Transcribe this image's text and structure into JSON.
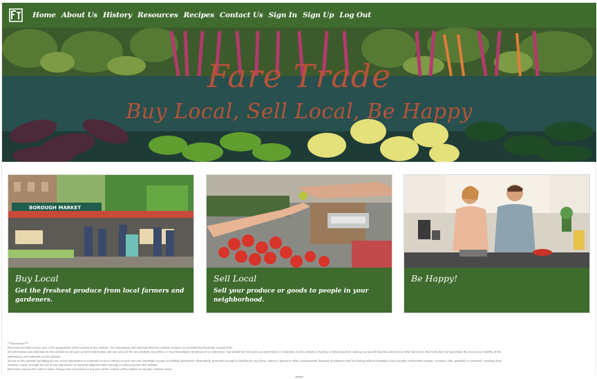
{
  "logo": {
    "text": "FT",
    "icon": "ft-logo-icon"
  },
  "nav": {
    "items": [
      {
        "label": "Home"
      },
      {
        "label": "About Us"
      },
      {
        "label": "History"
      },
      {
        "label": "Resources"
      },
      {
        "label": "Recipes"
      },
      {
        "label": "Contact Us"
      },
      {
        "label": "Sign In"
      },
      {
        "label": "Sign Up"
      },
      {
        "label": "Log Out"
      }
    ]
  },
  "hero": {
    "title": "Fare Trade",
    "tagline": "Buy Local, Sell Local, Be Happy"
  },
  "cards": [
    {
      "title": "Buy Local",
      "text": "Get the freshest produce from local farmers and gardeners.",
      "image_label": "BOROUGH MARKET"
    },
    {
      "title": "Sell Local",
      "text": "Sell your produce or goods to people in your neighborhood."
    },
    {
      "title": "Be Happy!",
      "text": ""
    }
  ],
  "disclaimer": {
    "heading": "***Disclaimer***",
    "lines": [
      "Faretrade has taken every care in the preparation of the content of this website. The information and materials that this website contains are provided by Faretrade in good faith.",
      "All information and materials on this website are for your general information and use only and do not constitute any advice or recommendation (professional or otherwise). You should not rely upon any information or materials on this website in making or refraining from making any specific business decision or other decisions. Faretrade does not guarantee the accuracy or validity of the",
      "information and materials on this website.",
      "Access to this website (including the use of any information or materials on it) is entirely at your own risk. Faretrade accepts no liability whatsoever. Particularly, faretrade accepts no liability for any direct, indirect, special or other consequential damages of whatever kind (including without limitation, loss of profits, anticipated savings, revenues, data, goodwill or contracts), resulting from",
      "whatever cause, through the use of any information or material obtained either directly or indirectly from this website.",
      "Faretrade reserves the right to make changes and corrections to any part of the content of this website at any time without notice."
    ]
  },
  "colors": {
    "brand_green": "#3f6b2e",
    "hero_text": "#b5533a"
  }
}
